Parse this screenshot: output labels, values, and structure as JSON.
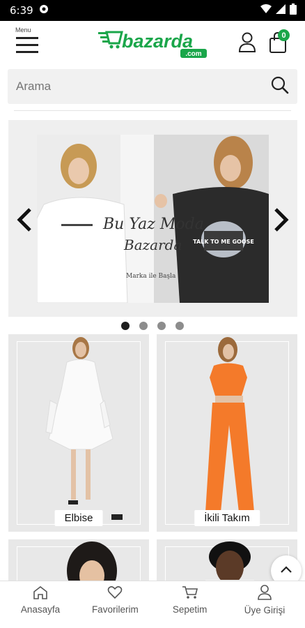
{
  "status_bar": {
    "time": "6:39"
  },
  "header": {
    "menu_label": "Menu",
    "logo_text": "bazarda",
    "logo_sub": ".com",
    "cart_count": "0",
    "brand_color": "#1aa64a"
  },
  "search": {
    "placeholder": "Arama"
  },
  "slider": {
    "slide_text_1": "Bu Yaz Moda",
    "slide_text_2": "Bazarda",
    "slide_caption": "Marka ile Başla",
    "shirt_print": "TALK TO ME GOOSE",
    "dots": 4,
    "active_dot": 0
  },
  "products": [
    {
      "label": "Elbise"
    },
    {
      "label": "İkili Takım"
    },
    {
      "label": ""
    },
    {
      "label": ""
    }
  ],
  "bottom_nav": {
    "home": "Anasayfa",
    "favorites": "Favorilerim",
    "cart": "Sepetim",
    "login": "Üye Girişi"
  }
}
